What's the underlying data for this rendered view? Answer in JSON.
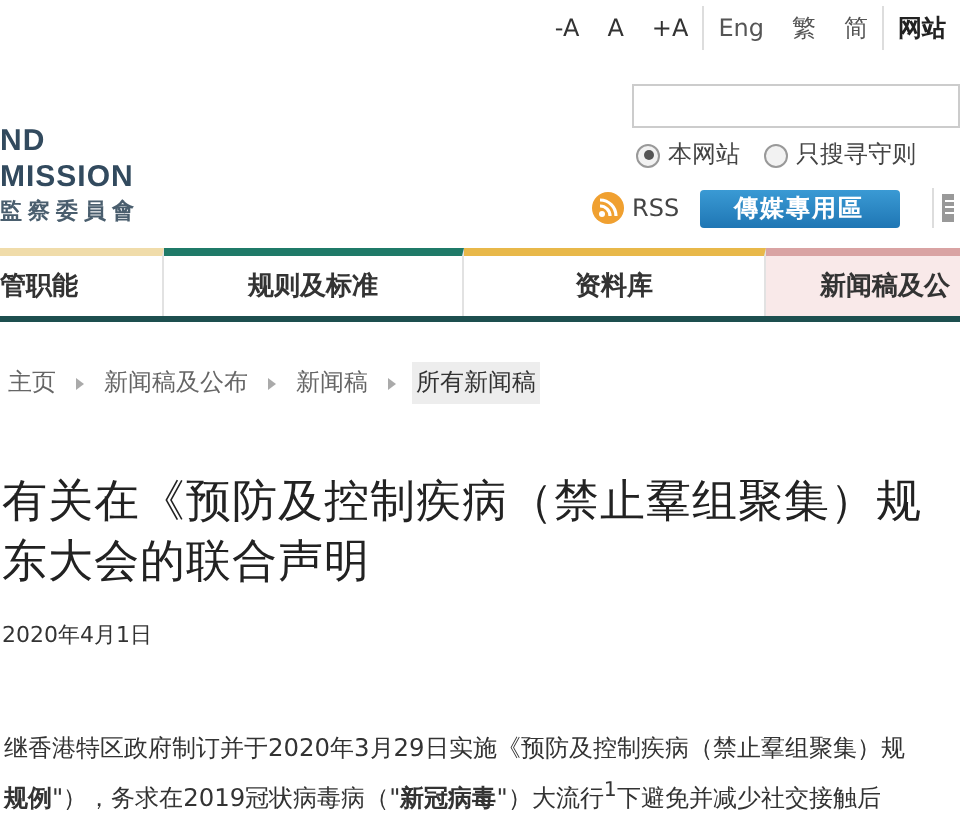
{
  "top_links": [
    {
      "label": "-A",
      "kind": "size"
    },
    {
      "label": "A",
      "kind": "size"
    },
    {
      "label": "+A",
      "kind": "size"
    },
    {
      "label": "Eng",
      "kind": "lang"
    },
    {
      "label": "繁",
      "kind": "lang"
    },
    {
      "label": "简",
      "kind": "lang"
    },
    {
      "label": "网站",
      "kind": "strong"
    }
  ],
  "logo": {
    "lines": [
      "ND",
      "MISSION",
      "監察委員會"
    ]
  },
  "search": {
    "scopes": [
      {
        "label": "本网站",
        "selected": true
      },
      {
        "label": "只搜寻守则",
        "selected": false
      }
    ]
  },
  "rss": {
    "label": "RSS"
  },
  "media_button": {
    "label": "傳媒專用區"
  },
  "nav": [
    {
      "label": "管职能",
      "color": "#f0dcaa",
      "selected": false
    },
    {
      "label": "规则及标准",
      "color": "#1f7a68",
      "selected": false
    },
    {
      "label": "资料库",
      "color": "#e8b84a",
      "selected": false
    },
    {
      "label": "新闻稿及公",
      "color": "#d9a3a3",
      "selected": true
    }
  ],
  "breadcrumb": [
    {
      "label": "主页",
      "current": false
    },
    {
      "label": "新闻稿及公布",
      "current": false
    },
    {
      "label": "新闻稿",
      "current": false
    },
    {
      "label": "所有新闻稿",
      "current": true
    }
  ],
  "title_lines": [
    "有关在《预防及控制疾病（禁止羣组聚集）规",
    "东大会的联合声明"
  ],
  "date": "2020年4月1日",
  "body_lines": [
    "继香港特区政府制订并于2020年3月29日实施《预防及控制疾病（禁止羣组聚集）规",
    "**规例**\"），务求在2019冠状病毒病（\"**新冠病毒**\"）大流行$^{1}$下避免并减少社交接触后"
  ]
}
